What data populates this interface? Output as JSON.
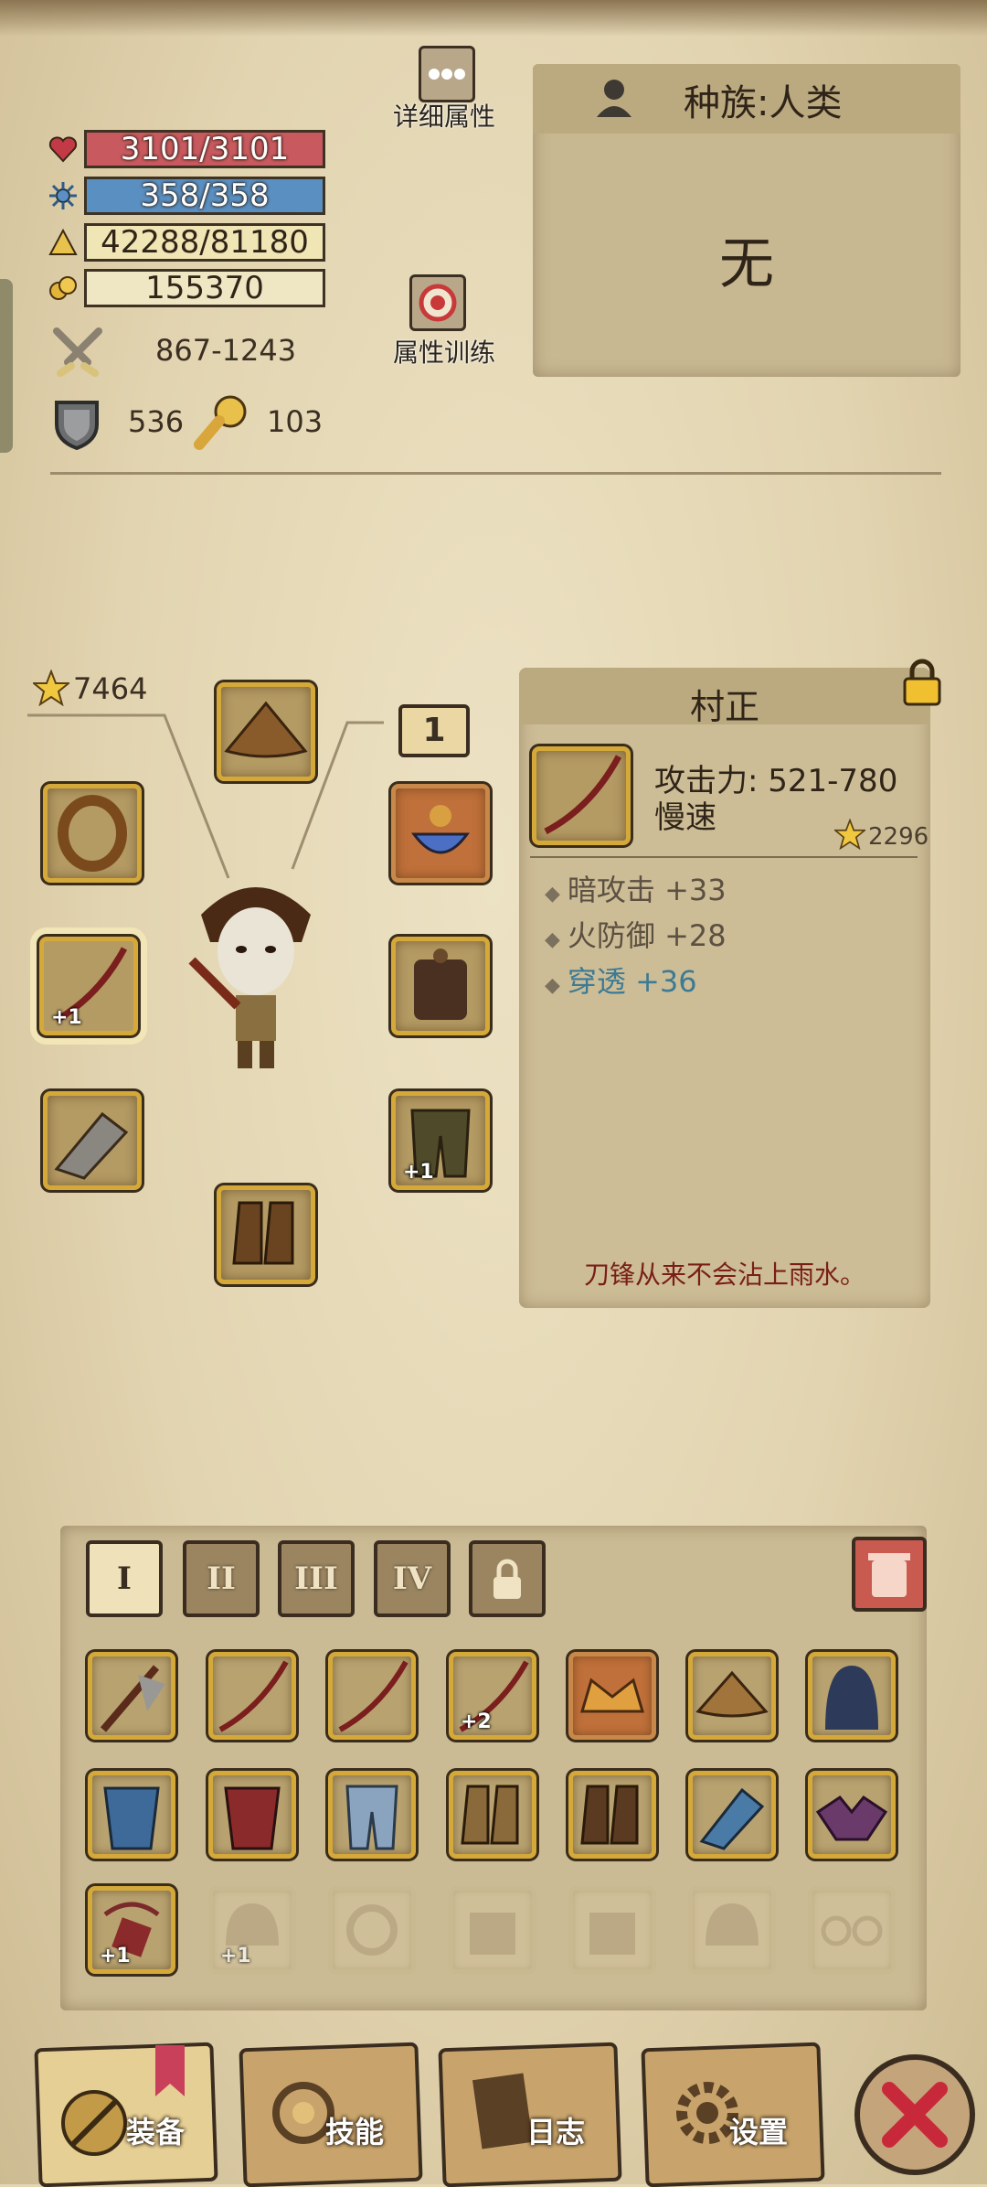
{
  "stats": {
    "hp": "3101/3101",
    "mp": "358/358",
    "exp": "42288/81180",
    "gold": "155370",
    "attack": "867-1243",
    "defense": "536",
    "other": "103"
  },
  "buttons": {
    "detail_label": "详细属性",
    "training_label": "属性训练"
  },
  "race": {
    "title": "种族:人类",
    "value": "无"
  },
  "equipment": {
    "star_score": "7464",
    "level_badge": "1",
    "slots": [
      {
        "name": "helmet",
        "plus": ""
      },
      {
        "name": "ring",
        "plus": ""
      },
      {
        "name": "weapon",
        "plus": "+1"
      },
      {
        "name": "gauntlet",
        "plus": ""
      },
      {
        "name": "boots",
        "plus": ""
      },
      {
        "name": "amulet",
        "plus": ""
      },
      {
        "name": "armor",
        "plus": ""
      },
      {
        "name": "pants",
        "plus": "+1"
      }
    ]
  },
  "item": {
    "name": "村正",
    "attack": "攻击力: 521-780",
    "speed": "慢速",
    "score": "2296",
    "props": [
      "暗攻击 +33",
      "火防御 +28",
      "穿透 +36"
    ],
    "quote": "刀锋从来不会沾上雨水。"
  },
  "inventory": {
    "tabs": [
      "I",
      "II",
      "III",
      "IV"
    ],
    "row1_plus": [
      "",
      "",
      "",
      "+2",
      "",
      "",
      ""
    ],
    "row3_plus": [
      "+1",
      "+1",
      "",
      "",
      "",
      "",
      ""
    ]
  },
  "nav": {
    "equip": "装备",
    "skills": "技能",
    "log": "日志",
    "settings": "设置"
  },
  "colors": {
    "hp": "#c85a5f",
    "mp": "#5a8fc1",
    "gold_border": "#d4a93a",
    "close": "#c8293a"
  }
}
